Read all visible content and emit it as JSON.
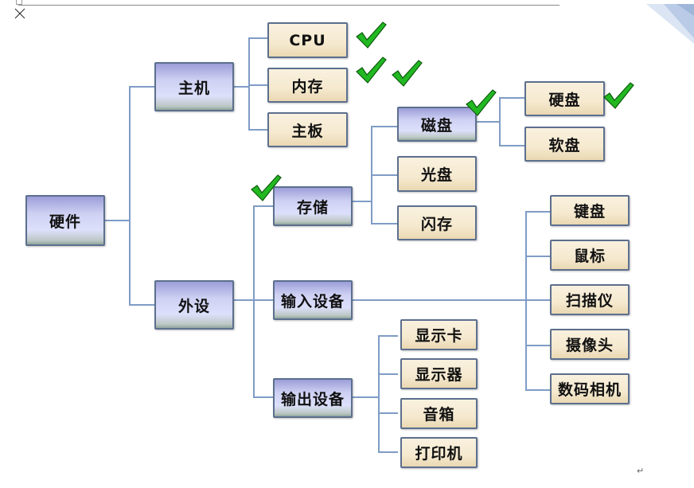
{
  "page": {
    "paragraph_mark": "↵",
    "close_icon": "close-x"
  },
  "colors": {
    "connector": "#7f9cc6",
    "category_fill": "#cdd0f2",
    "leaf_fill": "#f5e9cf",
    "check": "#22b822"
  },
  "tree": {
    "root": "硬件",
    "host": {
      "label": "主机",
      "children": [
        "CPU",
        "内存",
        "主板"
      ]
    },
    "peripheral": {
      "label": "外设",
      "storage": {
        "label": "存储",
        "disk": {
          "label": "磁盘",
          "children": [
            "硬盘",
            "软盘"
          ]
        },
        "optical": "光盘",
        "flash": "闪存"
      },
      "input": {
        "label": "输入设备",
        "children": [
          "键盘",
          "鼠标",
          "扫描仪",
          "摄像头",
          "数码相机"
        ]
      },
      "output": {
        "label": "输出设备",
        "children": [
          "显示卡",
          "显示器",
          "音箱",
          "打印机"
        ]
      }
    }
  },
  "checked_items": [
    "CPU",
    "内存",
    "内存",
    "磁盘",
    "硬盘",
    "存储"
  ]
}
